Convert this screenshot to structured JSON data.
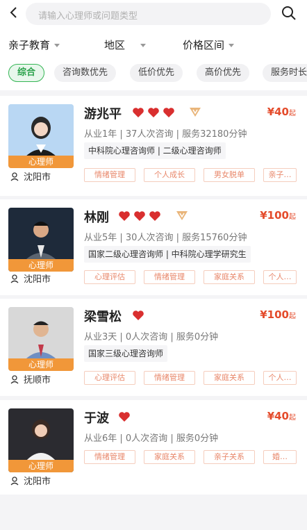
{
  "search": {
    "placeholder": "请输入心理师或问题类型"
  },
  "filters": [
    "亲子教育",
    "地区",
    "价格区间"
  ],
  "sorts": [
    "综合",
    "咨询数优先",
    "低价优先",
    "高价优先",
    "服务时长"
  ],
  "cards": [
    {
      "name": "游兆平",
      "role": "心理师",
      "hearts": 3,
      "vip": true,
      "price": "¥40",
      "price_unit": "起",
      "stats": "从业1年 | 37人次咨询 | 服务32180分钟",
      "cert": "中科院心理咨询师 | 二级心理咨询师",
      "city": "沈阳市",
      "tags": [
        "情绪管理",
        "个人成长",
        "男女脱单",
        "亲子…"
      ]
    },
    {
      "name": "林刚",
      "role": "心理师",
      "hearts": 3,
      "vip": true,
      "price": "¥100",
      "price_unit": "起",
      "stats": "从业5年 | 30人次咨询 | 服务15760分钟",
      "cert": "国家二级心理咨询师 | 中科院心理学研究生",
      "city": "沈阳市",
      "tags": [
        "心理评估",
        "情绪管理",
        "家庭关系",
        "个人…"
      ]
    },
    {
      "name": "梁雪松",
      "role": "心理师",
      "hearts": 1,
      "vip": false,
      "price": "¥100",
      "price_unit": "起",
      "stats": "从业3天 | 0人次咨询 | 服务0分钟",
      "cert": "国家三级心理咨询师",
      "city": "抚顺市",
      "tags": [
        "心理评估",
        "情绪管理",
        "家庭关系",
        "个人…"
      ]
    },
    {
      "name": "于波",
      "role": "心理师",
      "hearts": 1,
      "vip": false,
      "price": "¥40",
      "price_unit": "起",
      "stats": "从业6年 | 0人次咨询 | 服务0分钟",
      "cert": "",
      "city": "沈阳市",
      "tags": [
        "情绪管理",
        "家庭关系",
        "亲子关系",
        "婚…"
      ]
    }
  ]
}
